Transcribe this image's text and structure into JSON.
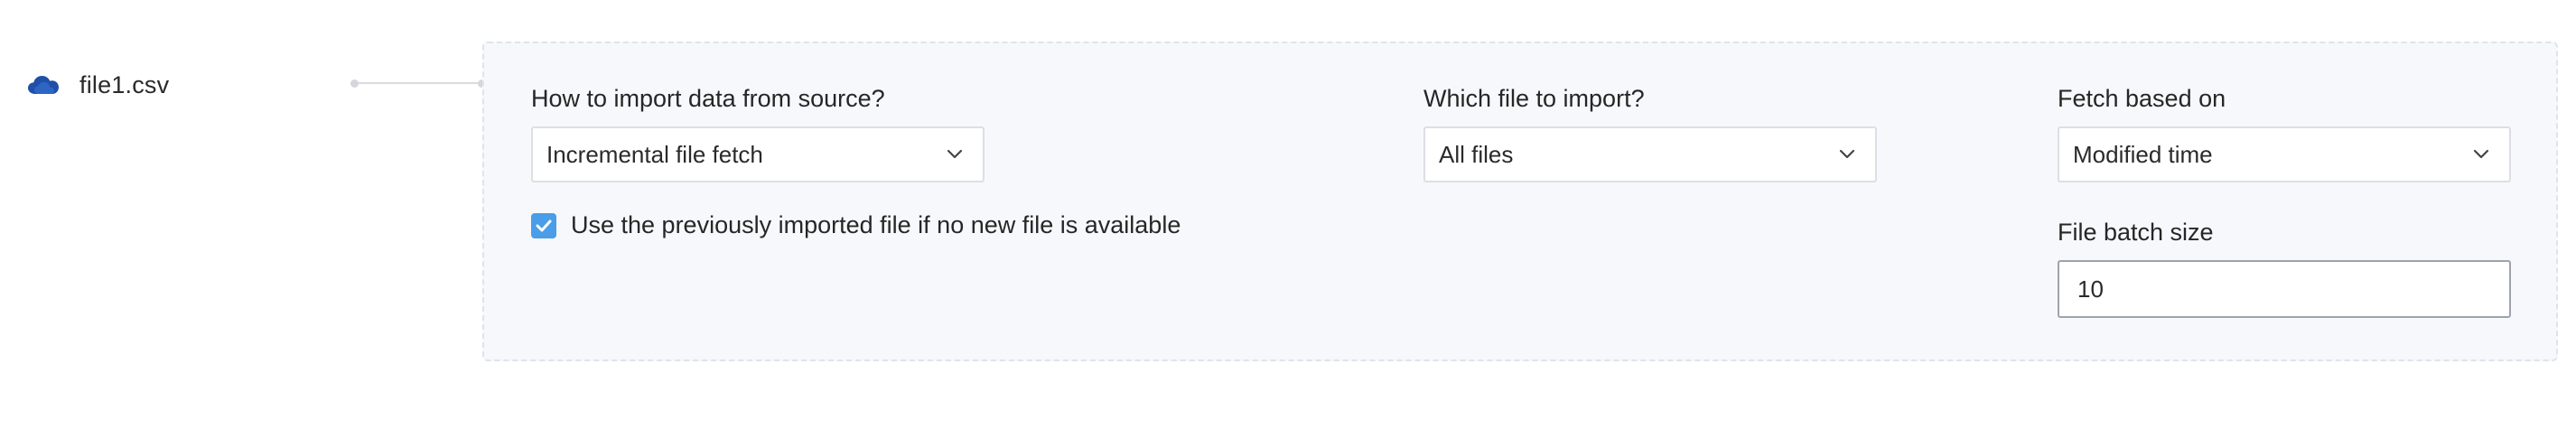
{
  "file": {
    "icon": "cloud-icon",
    "name": "file1.csv"
  },
  "import_settings": {
    "import_method": {
      "label": "How to import data from source?",
      "selected": "Incremental file fetch"
    },
    "use_previous_file": {
      "label": "Use the previously imported file if no new file is available",
      "checked": true
    },
    "file_to_import": {
      "label": "Which file to import?",
      "selected": "All files"
    },
    "fetch_based_on": {
      "label": "Fetch based on",
      "selected": "Modified time"
    },
    "file_batch_size": {
      "label": "File batch size",
      "value": "10"
    }
  },
  "colors": {
    "cloud_icon": "#1f4fa8",
    "checkbox_accent": "#4a9de8",
    "panel_background": "#f7f8fb"
  }
}
